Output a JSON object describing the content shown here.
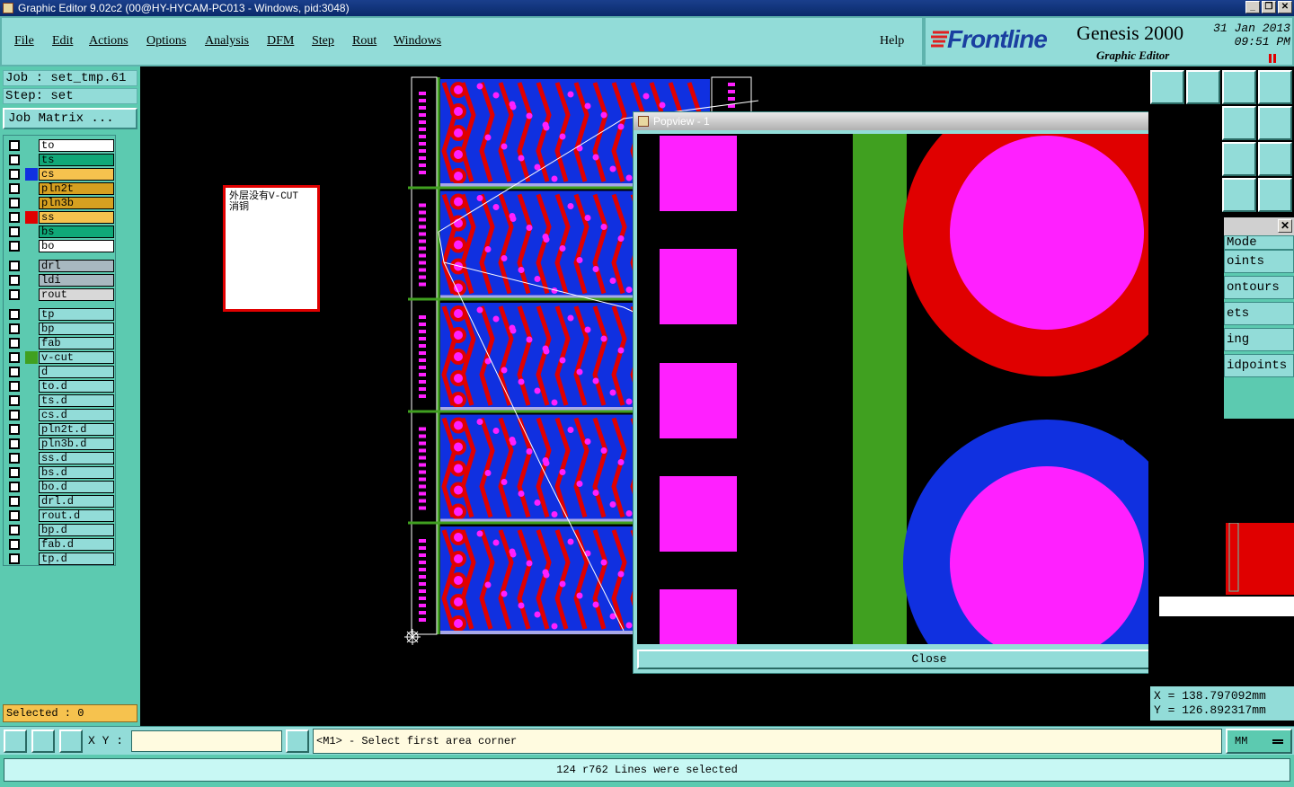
{
  "window": {
    "title": "Graphic Editor 9.02c2 (00@HY-HYCAM-PC013 - Windows, pid:3048)"
  },
  "menu": [
    {
      "label": "File"
    },
    {
      "label": "Edit"
    },
    {
      "label": "Actions"
    },
    {
      "label": "Options"
    },
    {
      "label": "Analysis"
    },
    {
      "label": "DFM"
    },
    {
      "label": "Step"
    },
    {
      "label": "Rout"
    },
    {
      "label": "Windows"
    },
    {
      "label": "Help"
    }
  ],
  "brand": {
    "name": "Frontline",
    "product": "Genesis 2000",
    "subtitle": "Graphic Editor",
    "date": "31 Jan 2013",
    "time": "09:51 PM"
  },
  "job": {
    "job_line": "Job : set_tmp.61",
    "step_line": "Step: set",
    "matrix_button": "Job Matrix ..."
  },
  "layers": [
    {
      "name": "to",
      "color": "#ffffff",
      "swatch": ""
    },
    {
      "name": "ts",
      "color": "#10a878",
      "swatch": ""
    },
    {
      "name": "cs",
      "color": "#f6c24e",
      "swatch": "#1030e0"
    },
    {
      "name": "pln2t",
      "color": "#d6a020",
      "swatch": ""
    },
    {
      "name": "pln3b",
      "color": "#d6a020",
      "swatch": ""
    },
    {
      "name": "ss",
      "color": "#f6c24e",
      "swatch": "#e00000"
    },
    {
      "name": "bs",
      "color": "#10a878",
      "swatch": ""
    },
    {
      "name": "bo",
      "color": "#ffffff",
      "swatch": ""
    },
    {
      "name": "drl",
      "color": "#a8b8c0",
      "swatch": ""
    },
    {
      "name": "ldi",
      "color": "#a8b8c0",
      "swatch": ""
    },
    {
      "name": "rout",
      "color": "#d8d8d8",
      "swatch": ""
    },
    {
      "name": "tp",
      "color": "#92dcd8",
      "swatch": ""
    },
    {
      "name": "bp",
      "color": "#92dcd8",
      "swatch": ""
    },
    {
      "name": "fab",
      "color": "#92dcd8",
      "swatch": ""
    },
    {
      "name": "v-cut",
      "color": "#92dcd8",
      "swatch": "#40a020"
    },
    {
      "name": "d",
      "color": "#92dcd8",
      "swatch": ""
    },
    {
      "name": "to.d",
      "color": "#92dcd8",
      "swatch": ""
    },
    {
      "name": "ts.d",
      "color": "#92dcd8",
      "swatch": ""
    },
    {
      "name": "cs.d",
      "color": "#92dcd8",
      "swatch": ""
    },
    {
      "name": "pln2t.d",
      "color": "#92dcd8",
      "swatch": ""
    },
    {
      "name": "pln3b.d",
      "color": "#92dcd8",
      "swatch": ""
    },
    {
      "name": "ss.d",
      "color": "#92dcd8",
      "swatch": ""
    },
    {
      "name": "bs.d",
      "color": "#92dcd8",
      "swatch": ""
    },
    {
      "name": "bo.d",
      "color": "#92dcd8",
      "swatch": ""
    },
    {
      "name": "drl.d",
      "color": "#92dcd8",
      "swatch": ""
    },
    {
      "name": "rout.d",
      "color": "#92dcd8",
      "swatch": ""
    },
    {
      "name": "bp.d",
      "color": "#92dcd8",
      "swatch": ""
    },
    {
      "name": "fab.d",
      "color": "#92dcd8",
      "swatch": ""
    },
    {
      "name": "tp.d",
      "color": "#92dcd8",
      "swatch": ""
    }
  ],
  "selected": "Selected : 0",
  "note": {
    "text": "外层没有V-CUT 消铜"
  },
  "popview": {
    "title": "Popview - 1",
    "close": "Close"
  },
  "modes": [
    {
      "label": "Mode"
    },
    {
      "label": "oints"
    },
    {
      "label": "ontours"
    },
    {
      "label": "ets"
    },
    {
      "label": "ing"
    },
    {
      "label": "idpoints"
    }
  ],
  "coords": {
    "x": "X = 138.797092mm",
    "y": "Y = 126.892317mm"
  },
  "command": {
    "xy_label": "X Y :",
    "xy_value": "",
    "prompt": "<M1> - Select first area corner",
    "units": "MM"
  },
  "status": "124 r762 Lines were selected",
  "colors": {
    "panel": "#92dcd8",
    "panel_dark": "#5ccab0",
    "copper_top": "#e00000",
    "copper_bottom": "#1030e0",
    "pad": "#ff20ff",
    "vcut": "#40a020"
  }
}
